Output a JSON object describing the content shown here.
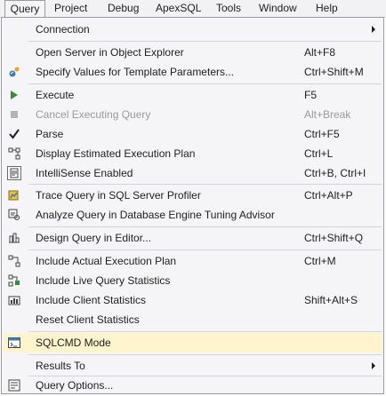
{
  "menubar": {
    "items": [
      {
        "label": "Query"
      },
      {
        "label": "Project"
      },
      {
        "label": "Debug"
      },
      {
        "label": "ApexSQL"
      },
      {
        "label": "Tools"
      },
      {
        "label": "Window"
      },
      {
        "label": "Help"
      }
    ]
  },
  "menu": {
    "items": [
      {
        "label": "Connection",
        "shortcut": "",
        "icon": "",
        "submenu": true
      },
      {
        "label": "Open Server in Object Explorer",
        "shortcut": "Alt+F8",
        "icon": ""
      },
      {
        "label": "Specify Values for Template Parameters...",
        "shortcut": "Ctrl+Shift+M",
        "icon": "template-params-icon"
      },
      {
        "label": "Execute",
        "shortcut": "F5",
        "icon": "play-icon"
      },
      {
        "label": "Cancel Executing Query",
        "shortcut": "Alt+Break",
        "icon": "stop-icon",
        "disabled": true
      },
      {
        "label": "Parse",
        "shortcut": "Ctrl+F5",
        "icon": "checkmark-icon"
      },
      {
        "label": "Display Estimated Execution Plan",
        "shortcut": "Ctrl+L",
        "icon": "execution-plan-icon"
      },
      {
        "label": "IntelliSense Enabled",
        "shortcut": "Ctrl+B, Ctrl+I",
        "icon": "intellisense-icon"
      },
      {
        "label": "Trace Query in SQL Server Profiler",
        "shortcut": "Ctrl+Alt+P",
        "icon": "profiler-icon"
      },
      {
        "label": "Analyze Query in Database Engine Tuning Advisor",
        "shortcut": "",
        "icon": "tuning-advisor-icon"
      },
      {
        "label": "Design Query in Editor...",
        "shortcut": "Ctrl+Shift+Q",
        "icon": "query-designer-icon"
      },
      {
        "label": "Include Actual Execution Plan",
        "shortcut": "Ctrl+M",
        "icon": "actual-plan-icon"
      },
      {
        "label": "Include Live Query Statistics",
        "shortcut": "",
        "icon": "live-stats-icon"
      },
      {
        "label": "Include Client Statistics",
        "shortcut": "Shift+Alt+S",
        "icon": "client-stats-icon"
      },
      {
        "label": "Reset Client Statistics",
        "shortcut": "",
        "icon": ""
      },
      {
        "label": "SQLCMD Mode",
        "shortcut": "",
        "icon": "sqlcmd-icon"
      },
      {
        "label": "Results To",
        "shortcut": "",
        "icon": "",
        "submenu": true
      },
      {
        "label": "Query Options...",
        "shortcut": "",
        "icon": "query-options-icon"
      }
    ]
  }
}
